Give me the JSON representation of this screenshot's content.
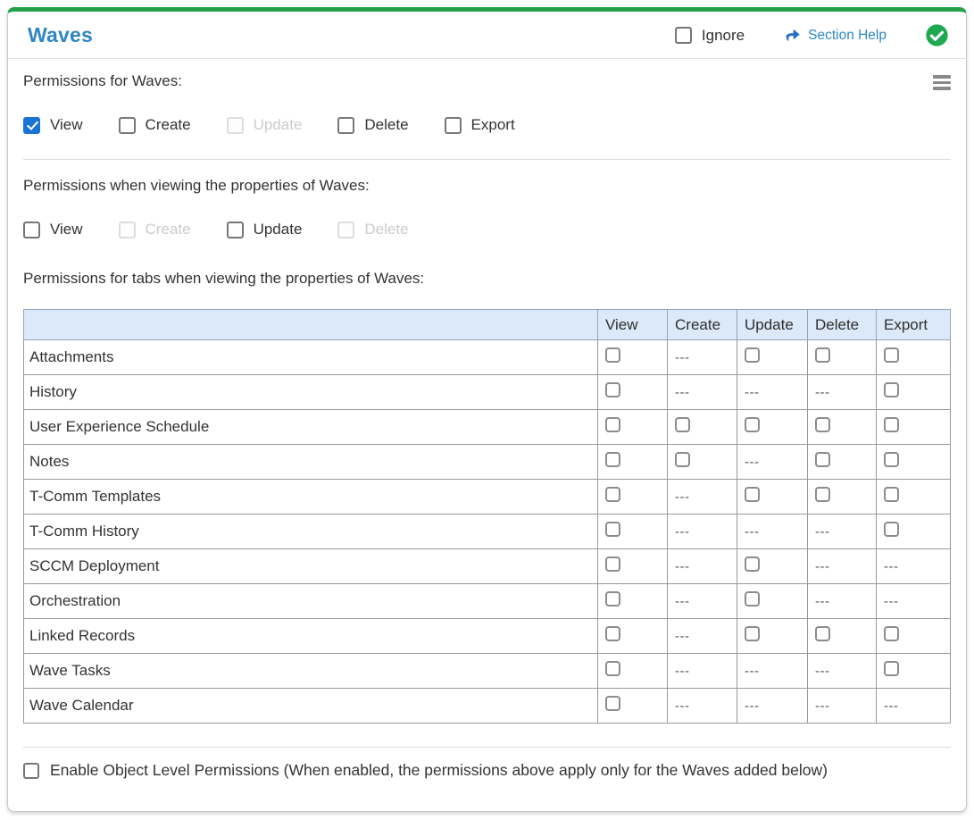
{
  "panel": {
    "title": "Waves",
    "ignore_label": "Ignore",
    "section_help_label": "Section Help"
  },
  "groups": [
    {
      "label": "Permissions for Waves:",
      "checkboxes": [
        {
          "label": "View",
          "state": "checked"
        },
        {
          "label": "Create",
          "state": "unchecked"
        },
        {
          "label": "Update",
          "state": "disabled"
        },
        {
          "label": "Delete",
          "state": "unchecked"
        },
        {
          "label": "Export",
          "state": "unchecked"
        }
      ]
    },
    {
      "label": "Permissions when viewing the properties of Waves:",
      "checkboxes": [
        {
          "label": "View",
          "state": "unchecked"
        },
        {
          "label": "Create",
          "state": "disabled"
        },
        {
          "label": "Update",
          "state": "unchecked"
        },
        {
          "label": "Delete",
          "state": "disabled"
        }
      ]
    }
  ],
  "table": {
    "intro": "Permissions for tabs when viewing the properties of Waves:",
    "columns": [
      "View",
      "Create",
      "Update",
      "Delete",
      "Export"
    ],
    "dash_text": "---",
    "rows": [
      {
        "name": "Attachments",
        "cells": [
          "checkbox",
          "dash",
          "checkbox",
          "checkbox",
          "checkbox"
        ]
      },
      {
        "name": "History",
        "cells": [
          "checkbox",
          "dash",
          "dash",
          "dash",
          "checkbox"
        ]
      },
      {
        "name": "User Experience Schedule",
        "cells": [
          "checkbox",
          "checkbox",
          "checkbox",
          "checkbox",
          "checkbox"
        ]
      },
      {
        "name": "Notes",
        "cells": [
          "checkbox",
          "checkbox",
          "dash",
          "checkbox",
          "checkbox"
        ]
      },
      {
        "name": "T-Comm Templates",
        "cells": [
          "checkbox",
          "dash",
          "checkbox",
          "checkbox",
          "checkbox"
        ]
      },
      {
        "name": "T-Comm History",
        "cells": [
          "checkbox",
          "dash",
          "dash",
          "dash",
          "checkbox"
        ]
      },
      {
        "name": "SCCM Deployment",
        "cells": [
          "checkbox",
          "dash",
          "checkbox",
          "dash",
          "dash"
        ]
      },
      {
        "name": "Orchestration",
        "cells": [
          "checkbox",
          "dash",
          "checkbox",
          "dash",
          "dash"
        ]
      },
      {
        "name": "Linked Records",
        "cells": [
          "checkbox",
          "dash",
          "checkbox",
          "checkbox",
          "checkbox"
        ]
      },
      {
        "name": "Wave Tasks",
        "cells": [
          "checkbox",
          "dash",
          "dash",
          "dash",
          "checkbox"
        ]
      },
      {
        "name": "Wave Calendar",
        "cells": [
          "checkbox",
          "dash",
          "dash",
          "dash",
          "dash"
        ]
      }
    ]
  },
  "footer": {
    "enable_olp_label": "Enable Object Level Permissions (When enabled, the permissions above apply only for the Waves added below)"
  },
  "colors": {
    "card_top_border": "#24a148",
    "title_blue": "#2e86c5",
    "link_blue": "#2e86c5",
    "link_arrow_blue": "#2a6fc2",
    "checked_checkbox_blue": "#1b74d3",
    "table_header_bg": "#dbe9f8",
    "status_badge_green": "#1ea850"
  }
}
